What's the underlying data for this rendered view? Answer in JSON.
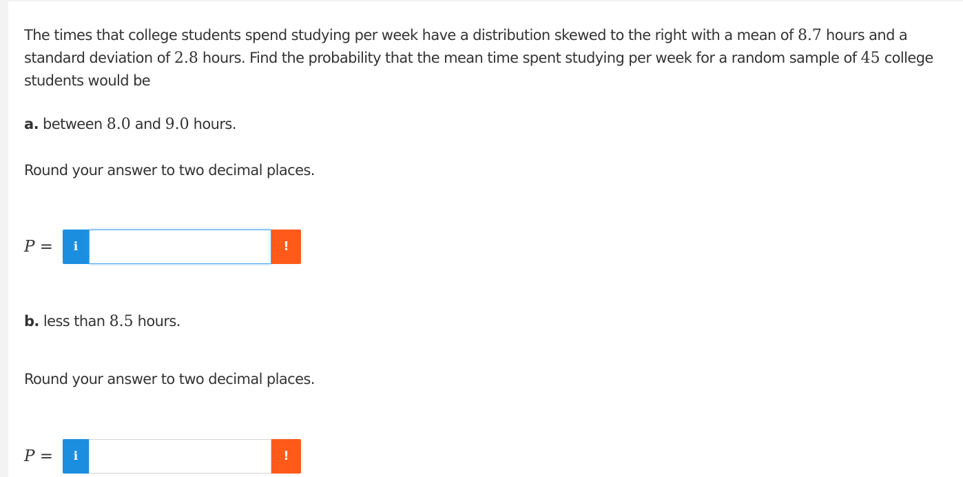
{
  "question": {
    "intro_1": "The times that college students spend studying per week have a distribution skewed to the right with a mean of ",
    "mean": "8.7",
    "intro_2": " hours and a standard deviation of ",
    "sd": "2.8",
    "intro_3": " hours. Find the probability that the mean time spent studying per week for a random sample of ",
    "n": "45",
    "intro_4": " college students would be"
  },
  "part_a": {
    "label": "a.",
    "text_1": " between ",
    "low": "8.0",
    "text_2": " and ",
    "high": "9.0",
    "text_3": " hours.",
    "instruction": "Round your answer to two decimal places.",
    "answer": {
      "var": "P",
      "eq": " = ",
      "info_icon": "i",
      "value": "",
      "warn_icon": "!"
    }
  },
  "part_b": {
    "label": "b.",
    "text_1": " less than ",
    "value": "8.5",
    "text_2": " hours.",
    "instruction": "Round your answer to two decimal places.",
    "answer": {
      "var": "P",
      "eq": " = ",
      "info_icon": "i",
      "value": "",
      "warn_icon": "!"
    }
  },
  "colors": {
    "info": "#1c8ee0",
    "warning": "#ff5a1a",
    "text": "#333333"
  }
}
